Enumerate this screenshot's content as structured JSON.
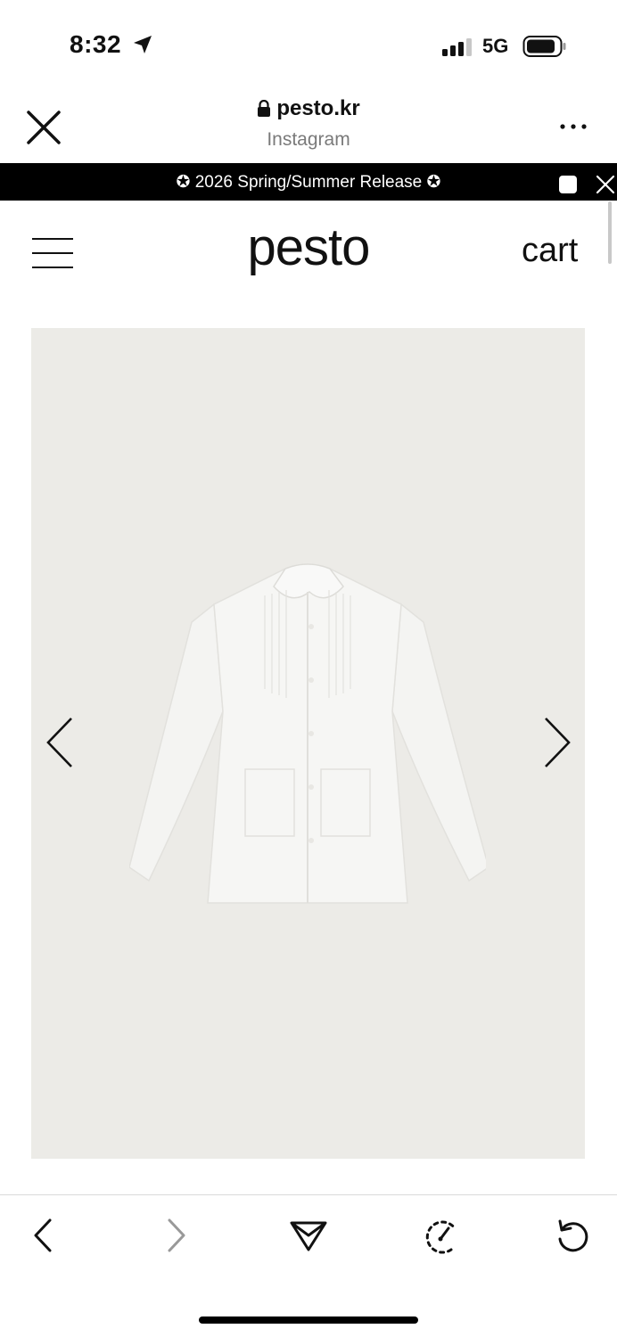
{
  "status_bar": {
    "time": "8:32",
    "network": "5G",
    "location_icon": "location-arrow-icon",
    "signal_icon": "cellular-signal-icon",
    "battery_icon": "battery-icon"
  },
  "browser": {
    "domain": "pesto.kr",
    "source": "Instagram",
    "close_icon": "close-icon",
    "more_icon": "more-options-icon"
  },
  "announcement": {
    "text": "✪ 2026 Spring/Summer Release ✪"
  },
  "site_header": {
    "brand": "pesto",
    "cart_label": "cart",
    "menu_icon": "hamburger-menu-icon"
  },
  "product": {
    "image_icon": "white-pintuck-shirt-image",
    "prev_icon": "chevron-left-icon",
    "next_icon": "chevron-right-icon"
  },
  "toolbar": {
    "back_icon": "back-icon",
    "forward_icon": "forward-icon",
    "share_icon": "share-icon",
    "speed_icon": "speedometer-icon",
    "reload_icon": "reload-icon"
  },
  "colors": {
    "announcement_bg": "#000000",
    "product_bg": "#ecebe7",
    "text": "#111111",
    "muted": "#7a7a7a"
  }
}
